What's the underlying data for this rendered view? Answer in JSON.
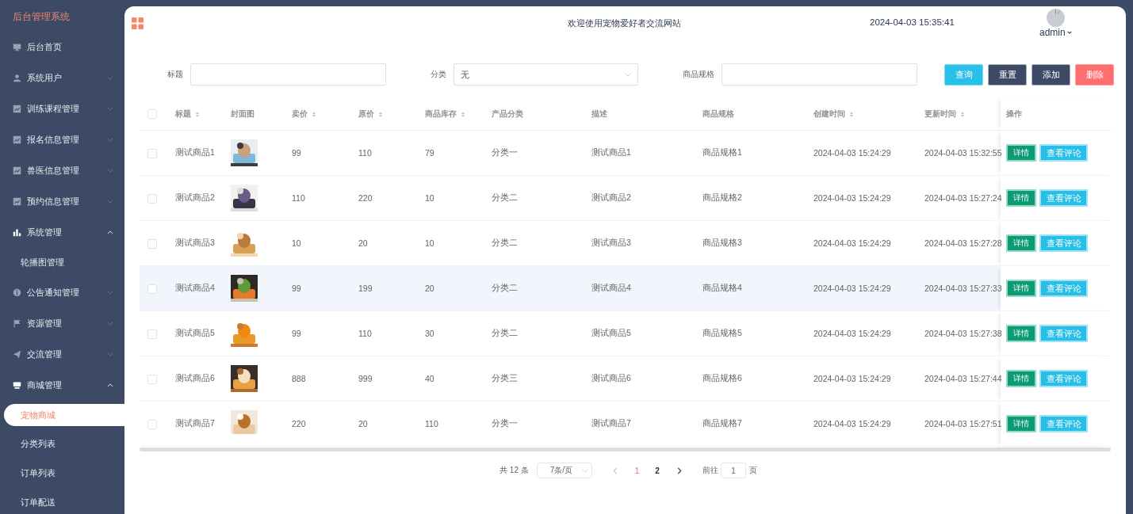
{
  "sidebar": {
    "title": "后台管理系统",
    "items": [
      {
        "label": "后台首页",
        "selected": false
      },
      {
        "label": "系统用户",
        "selected": false,
        "expanded": false
      },
      {
        "label": "训练课程管理",
        "selected": false,
        "expanded": false
      },
      {
        "label": "报名信息管理",
        "selected": false,
        "expanded": false
      },
      {
        "label": "兽医信息管理",
        "selected": false,
        "expanded": false
      },
      {
        "label": "预约信息管理",
        "selected": false,
        "expanded": false
      },
      {
        "label": "系统管理",
        "selected": false,
        "expanded": true,
        "children": [
          {
            "label": "轮播图管理",
            "selected": false
          }
        ]
      },
      {
        "label": "公告通知管理",
        "selected": false,
        "expanded": false
      },
      {
        "label": "资源管理",
        "selected": false,
        "expanded": false
      },
      {
        "label": "交流管理",
        "selected": false,
        "expanded": false
      },
      {
        "label": "商城管理",
        "selected": false,
        "expanded": true,
        "children": [
          {
            "label": "宠物商城",
            "selected": true
          },
          {
            "label": "分类列表",
            "selected": false
          },
          {
            "label": "订单列表",
            "selected": false
          },
          {
            "label": "订单配送",
            "selected": false
          }
        ]
      }
    ]
  },
  "header": {
    "welcome": "欢迎使用宠物爱好者交流网站",
    "datetime": "2024-04-03 15:35:41",
    "user": "admin"
  },
  "search": {
    "fields": [
      {
        "label": "标题",
        "kind": "input"
      },
      {
        "label": "分类",
        "kind": "select",
        "value": "无"
      },
      {
        "label": "商品规格",
        "kind": "input"
      }
    ],
    "buttons": [
      {
        "label": "查询",
        "kind": "query"
      },
      {
        "label": "重置",
        "kind": "dark"
      },
      {
        "label": "添加",
        "kind": "dark"
      },
      {
        "label": "删除",
        "kind": "danger"
      }
    ]
  },
  "table": {
    "select_all": {
      "checked": false
    },
    "columns": [
      {
        "kind": "checkbox"
      },
      {
        "label": "标题",
        "kind": "text",
        "sortable": true
      },
      {
        "label": "封面图",
        "kind": "picture",
        "sortable": false
      },
      {
        "label": "卖价",
        "kind": "text",
        "sortable": true
      },
      {
        "label": "原价",
        "kind": "text",
        "sortable": true
      },
      {
        "label": "商品库存",
        "kind": "text",
        "sortable": true
      },
      {
        "label": "产品分类",
        "kind": "text",
        "sortable": false
      },
      {
        "label": "描述",
        "kind": "text",
        "sortable": false
      },
      {
        "label": "商品规格",
        "kind": "text",
        "sortable": false
      },
      {
        "label": "创建时间",
        "kind": "text",
        "sortable": true
      },
      {
        "label": "更新时间",
        "kind": "text",
        "sortable": true
      },
      {
        "label": "操作",
        "kind": "actions",
        "sortable": false
      }
    ],
    "rows": [
      {
        "checked": false,
        "hovered": false,
        "cells": [
          "",
          "测试商品1",
          "",
          "99",
          "110",
          "79",
          "分类一",
          "测试商品1",
          "商品规格1",
          "2024-04-03 15:24:29",
          "2024-04-03 15:32:55"
        ],
        "actions": [
          {
            "label": "详情",
            "kind": "detail"
          },
          {
            "label": "查看评论",
            "kind": "comments"
          }
        ]
      },
      {
        "checked": false,
        "hovered": false,
        "cells": [
          "",
          "测试商品2",
          "",
          "110",
          "220",
          "10",
          "分类二",
          "测试商品2",
          "商品规格2",
          "2024-04-03 15:24:29",
          "2024-04-03 15:27:24"
        ],
        "actions": [
          {
            "label": "详情",
            "kind": "detail"
          },
          {
            "label": "查看评论",
            "kind": "comments"
          }
        ]
      },
      {
        "checked": false,
        "hovered": false,
        "cells": [
          "",
          "测试商品3",
          "",
          "10",
          "20",
          "10",
          "分类二",
          "测试商品3",
          "商品规格3",
          "2024-04-03 15:24:29",
          "2024-04-03 15:27:28"
        ],
        "actions": [
          {
            "label": "详情",
            "kind": "detail"
          },
          {
            "label": "查看评论",
            "kind": "comments"
          }
        ]
      },
      {
        "checked": false,
        "hovered": true,
        "cells": [
          "",
          "测试商品4",
          "",
          "99",
          "199",
          "20",
          "分类二",
          "测试商品4",
          "商品规格4",
          "2024-04-03 15:24:29",
          "2024-04-03 15:27:33"
        ],
        "actions": [
          {
            "label": "详情",
            "kind": "detail"
          },
          {
            "label": "查看评论",
            "kind": "comments"
          }
        ]
      },
      {
        "checked": false,
        "hovered": false,
        "cells": [
          "",
          "测试商品5",
          "",
          "99",
          "110",
          "30",
          "分类二",
          "测试商品5",
          "商品规格5",
          "2024-04-03 15:24:29",
          "2024-04-03 15:27:38"
        ],
        "actions": [
          {
            "label": "详情",
            "kind": "detail"
          },
          {
            "label": "查看评论",
            "kind": "comments"
          }
        ]
      },
      {
        "checked": false,
        "hovered": false,
        "cells": [
          "",
          "测试商品6",
          "",
          "888",
          "999",
          "40",
          "分类三",
          "测试商品6",
          "商品规格6",
          "2024-04-03 15:24:29",
          "2024-04-03 15:27:44"
        ],
        "actions": [
          {
            "label": "详情",
            "kind": "detail"
          },
          {
            "label": "查看评论",
            "kind": "comments"
          }
        ]
      },
      {
        "checked": false,
        "hovered": false,
        "cells": [
          "",
          "测试商品7",
          "",
          "220",
          "20",
          "110",
          "分类一",
          "测试商品7",
          "商品规格7",
          "2024-04-03 15:24:29",
          "2024-04-03 15:27:51"
        ],
        "actions": [
          {
            "label": "详情",
            "kind": "detail"
          },
          {
            "label": "查看评论",
            "kind": "comments"
          }
        ]
      }
    ]
  },
  "pagination": {
    "total": "共 12 条",
    "page_size": "7条/页",
    "pages": [
      {
        "label": "1",
        "selected": true
      },
      {
        "label": "2",
        "selected": false
      }
    ],
    "prev_disabled": true,
    "goto_label": "前往",
    "goto_value": "1",
    "goto_unit": "页"
  }
}
